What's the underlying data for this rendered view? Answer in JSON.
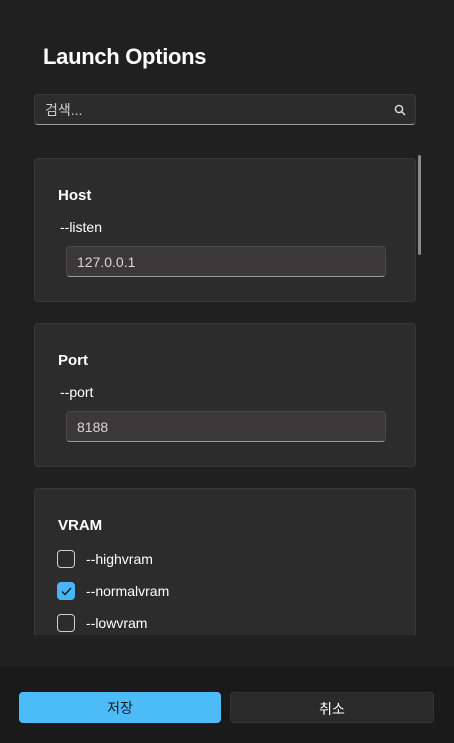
{
  "dialog": {
    "title": "Launch Options",
    "search": {
      "placeholder": "검색..."
    },
    "sections": [
      {
        "title": "Host",
        "option": "--listen",
        "value": "127.0.0.1"
      },
      {
        "title": "Port",
        "option": "--port",
        "value": "8188"
      },
      {
        "title": "VRAM",
        "checkboxes": [
          {
            "label": "--highvram",
            "checked": false
          },
          {
            "label": "--normalvram",
            "checked": true
          },
          {
            "label": "--lowvram",
            "checked": false
          }
        ]
      }
    ],
    "buttons": {
      "save": "저장",
      "cancel": "취소"
    }
  },
  "colors": {
    "accent": "#4bbcf7",
    "background": "#202020",
    "card": "#2b2c2b"
  },
  "icons": {
    "search": "search-icon",
    "check": "checkmark-icon"
  }
}
